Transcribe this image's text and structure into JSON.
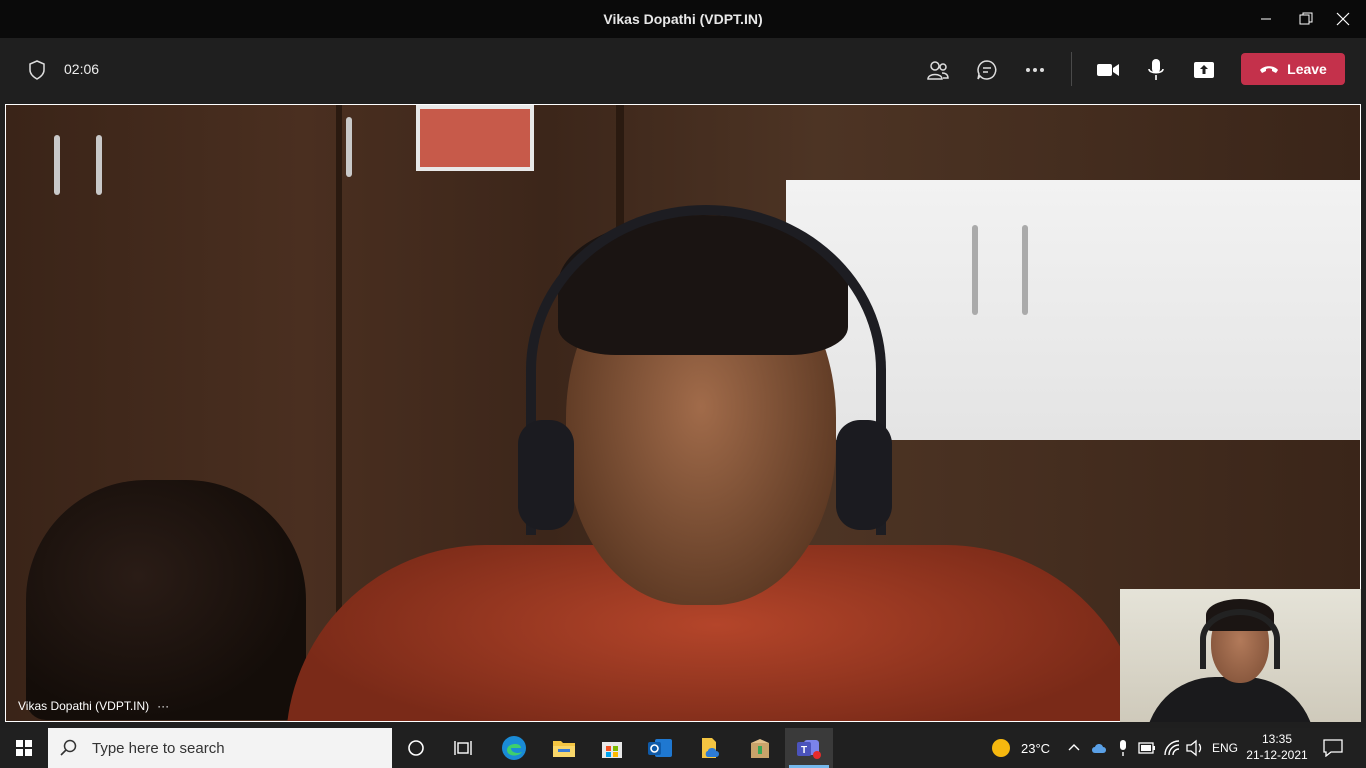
{
  "window": {
    "title": "Vikas Dopathi (VDPT.IN)",
    "controls": [
      "minimize-icon",
      "restore-icon",
      "close-icon"
    ]
  },
  "meeting_bar": {
    "timer": "02:06",
    "leave_label": "Leave",
    "icons": [
      "shield-icon",
      "participants-icon",
      "chat-icon",
      "more-icon",
      "camera-icon",
      "mic-icon",
      "share-icon",
      "phone-icon"
    ],
    "leave_color": "#c4314b"
  },
  "stage": {
    "participant_name": "Vikas Dopathi (VDPT.IN)",
    "more_label": "···"
  },
  "taskbar": {
    "search_placeholder": "Type here to search",
    "weather": "23°C",
    "language": "ENG",
    "time": "13:35",
    "date": "21-12-2021",
    "apps": [
      "cortana-icon",
      "task-view-icon",
      "edge-icon",
      "file-explorer-icon",
      "store-icon",
      "outlook-icon",
      "onedrive-icon",
      "installer-icon",
      "teams-icon"
    ]
  }
}
